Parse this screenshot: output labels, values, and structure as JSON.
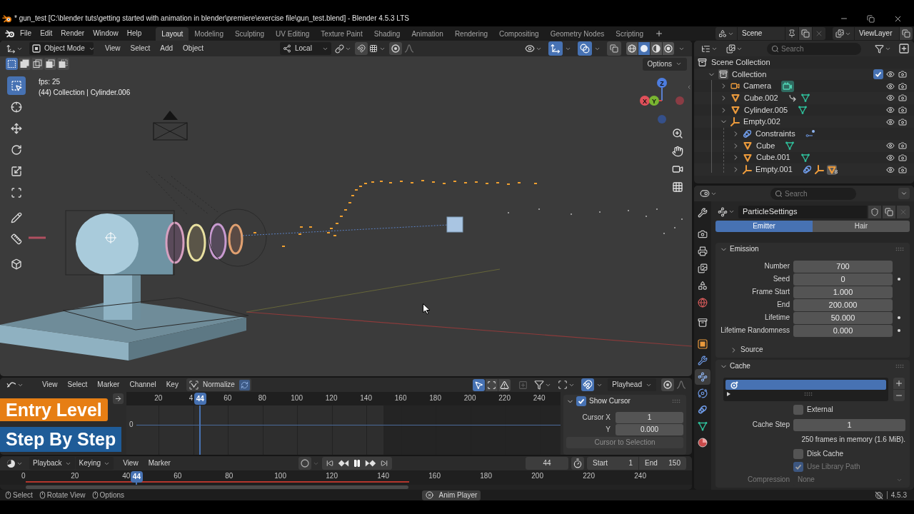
{
  "window": {
    "title": "* gun_test [C:\\blender tuts\\getting started with animation in blender\\premiere\\exercise file\\gun_test.blend] - Blender 4.5.3 LTS"
  },
  "top_bar": {
    "menus": [
      "File",
      "Edit",
      "Render",
      "Window",
      "Help"
    ],
    "workspaces": [
      {
        "label": "Layout",
        "selected": true
      },
      {
        "label": "Modeling",
        "selected": false
      },
      {
        "label": "Sculpting",
        "selected": false
      },
      {
        "label": "UV Editing",
        "selected": false
      },
      {
        "label": "Texture Paint",
        "selected": false
      },
      {
        "label": "Shading",
        "selected": false
      },
      {
        "label": "Animation",
        "selected": false
      },
      {
        "label": "Rendering",
        "selected": false
      },
      {
        "label": "Compositing",
        "selected": false
      },
      {
        "label": "Geometry Nodes",
        "selected": false
      },
      {
        "label": "Scripting",
        "selected": false
      }
    ],
    "scene": "Scene",
    "view_layer": "ViewLayer"
  },
  "viewport": {
    "header": {
      "mode": "Object Mode",
      "menus": [
        "View",
        "Select",
        "Add",
        "Object"
      ],
      "orientation": "Local",
      "gizmos": {
        "on": true
      },
      "overlays": {
        "on": true
      },
      "xray": {
        "on": false
      },
      "shading": [
        {
          "selected": false
        },
        {
          "selected": true
        },
        {
          "selected": false
        },
        {
          "selected": false
        }
      ]
    },
    "select_modes": [
      {
        "selected": true
      },
      {
        "selected": false
      },
      {
        "selected": false
      },
      {
        "selected": false
      },
      {
        "selected": false
      }
    ],
    "options": "Options",
    "tools": [
      {
        "selected": true
      },
      {
        "selected": false
      },
      {
        "selected": false
      },
      {
        "selected": false
      },
      {
        "selected": false
      },
      {
        "selected": false
      },
      {
        "selected": false
      },
      {
        "selected": false
      },
      {
        "selected": false
      }
    ],
    "info": [
      "fps: 25",
      "(44) Collection | Cylinder.006"
    ],
    "axes": [
      "X",
      "Y",
      "Z"
    ]
  },
  "graph_editor": {
    "menus": [
      "View",
      "Select",
      "Marker",
      "Channel",
      "Key"
    ],
    "normalize": {
      "label": "Normalize",
      "on": false
    },
    "only_selected": {
      "on": true
    },
    "snap": {
      "on": true
    },
    "pivot": "Playhead",
    "ruler": [
      "20",
      "4",
      "60",
      "80",
      "100",
      "120",
      "140",
      "160",
      "180",
      "200",
      "220",
      "240"
    ],
    "playhead": "44",
    "value_label": "0",
    "sidebar": {
      "title": "Show Cursor",
      "checked": true,
      "expanded": true,
      "fields": [
        {
          "label": "Cursor X",
          "value": "1"
        },
        {
          "label": "Y",
          "value": "0.000"
        }
      ],
      "button": "Cursor to Selection"
    }
  },
  "overlay_banners": [
    {
      "text": "Entry Level",
      "color": "#e67e14"
    },
    {
      "text": "Step By Step",
      "color": "#1f5c98"
    }
  ],
  "timeline": {
    "dropdowns": [
      "Playback",
      "Keying"
    ],
    "menus": [
      "View",
      "Marker"
    ],
    "auto_keying": {
      "on": false
    },
    "playing": true,
    "current_frame": "44",
    "start": {
      "label": "Start",
      "value": "1"
    },
    "end": {
      "label": "End",
      "value": "150"
    },
    "ruler": [
      "0",
      "20",
      "40",
      "60",
      "80",
      "100",
      "120",
      "140",
      "160",
      "180",
      "200",
      "220",
      "240"
    ],
    "playhead": "44"
  },
  "outliner": {
    "search_placeholder": "Search",
    "tree": [
      {
        "name": "Scene Collection",
        "kind": "scene_collection",
        "children": [
          {
            "name": "Collection",
            "kind": "collection",
            "expanded": true,
            "checked": true,
            "children": [
              {
                "name": "Camera",
                "kind": "camera",
                "expanded": false,
                "extras": [
                  {
                    "kind": "camera_data"
                  }
                ]
              },
              {
                "name": "Cube.002",
                "kind": "mesh",
                "expanded": false,
                "extras": [
                  {
                    "kind": "relation"
                  },
                  {
                    "kind": "mesh_data"
                  }
                ]
              },
              {
                "name": "Cylinder.005",
                "kind": "mesh",
                "expanded": false,
                "extras": [
                  {
                    "kind": "mesh_data"
                  }
                ]
              },
              {
                "name": "Empty.002",
                "kind": "empty",
                "expanded": true,
                "children": [
                  {
                    "name": "Constraints",
                    "kind": "constraints",
                    "expanded": false,
                    "extras": [
                      {
                        "kind": "constraint"
                      }
                    ]
                  },
                  {
                    "name": "Cube",
                    "kind": "mesh",
                    "expanded": false,
                    "extras": [
                      {
                        "kind": "mesh_data"
                      }
                    ]
                  },
                  {
                    "name": "Cube.001",
                    "kind": "mesh",
                    "expanded": false,
                    "extras": [
                      {
                        "kind": "mesh_data"
                      }
                    ]
                  },
                  {
                    "name": "Empty.001",
                    "kind": "empty",
                    "expanded": false,
                    "extras": [
                      {
                        "kind": "constraints"
                      },
                      {
                        "kind": "empty"
                      },
                      {
                        "kind": "mesh",
                        "count": "8"
                      }
                    ]
                  }
                ]
              }
            ]
          }
        ]
      }
    ]
  },
  "properties": {
    "search_placeholder": "Search",
    "tabs": [
      {
        "selected": false
      },
      {
        "selected": false
      },
      {
        "selected": false
      },
      {
        "selected": false
      },
      {
        "selected": false
      },
      {
        "selected": false
      },
      {
        "selected": false
      },
      {
        "selected": false
      },
      {
        "selected": false
      },
      {
        "selected": true
      },
      {
        "selected": false
      },
      {
        "selected": false
      },
      {
        "selected": false
      },
      {
        "selected": false
      }
    ],
    "datablock": "ParticleSettings",
    "types": [
      {
        "label": "Emitter",
        "selected": true
      },
      {
        "label": "Hair",
        "selected": false
      }
    ],
    "panels": [
      {
        "title": "Emission",
        "expanded": true,
        "rows": [
          {
            "kind": "field",
            "label": "Number",
            "value": "700",
            "decorator": false
          },
          {
            "kind": "field",
            "label": "Seed",
            "value": "0",
            "decorator": true
          },
          {
            "kind": "field",
            "label": "Frame Start",
            "value": "1.000",
            "decorator": false
          },
          {
            "kind": "field",
            "label": "End",
            "value": "200.000",
            "decorator": false
          },
          {
            "kind": "field",
            "label": "Lifetime",
            "value": "50.000",
            "decorator": true
          },
          {
            "kind": "field",
            "label": "Lifetime Randomness",
            "value": "0.000",
            "decorator": true
          },
          {
            "kind": "subpanel",
            "title": "Source",
            "expanded": false
          }
        ]
      },
      {
        "title": "Cache",
        "expanded": true,
        "rows": [
          {
            "kind": "list",
            "items": [
              {
                "selected": true
              }
            ]
          },
          {
            "kind": "checkbox",
            "label": "External",
            "checked": false,
            "disabled": false
          },
          {
            "kind": "field",
            "label": "Cache Step",
            "value": "1"
          },
          {
            "kind": "info",
            "text": "250 frames in memory (1.6 MiB)."
          },
          {
            "kind": "checkbox",
            "label": "Disk Cache",
            "checked": false,
            "disabled": false
          },
          {
            "kind": "checkbox",
            "label": "Use Library Path",
            "checked": true,
            "disabled": true
          },
          {
            "kind": "dropdown",
            "label": "Compression",
            "value": "None",
            "disabled": true
          }
        ]
      }
    ]
  },
  "status_bar": {
    "hints": [
      "Select",
      "Rotate View",
      "Options"
    ],
    "job": "Anim Player",
    "version": "4.5.3"
  }
}
